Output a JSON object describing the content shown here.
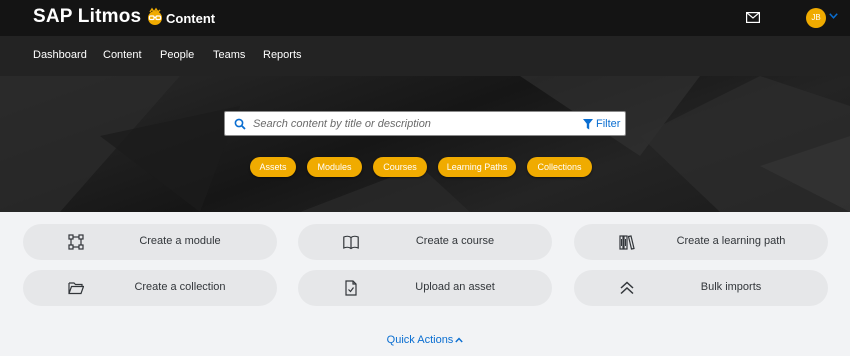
{
  "header": {
    "logo_text": "SAP Litmos",
    "app_title": "Content",
    "avatar_initials": "JB",
    "avatar_color": "#f0ab00"
  },
  "nav": {
    "items": [
      {
        "label": "Dashboard"
      },
      {
        "label": "Content"
      },
      {
        "label": "People"
      },
      {
        "label": "Teams"
      },
      {
        "label": "Reports"
      }
    ]
  },
  "search": {
    "placeholder": "Search content by title or description",
    "value": "",
    "filter_label": "Filter"
  },
  "chips": [
    {
      "label": "Assets"
    },
    {
      "label": "Modules"
    },
    {
      "label": "Courses"
    },
    {
      "label": "Learning Paths"
    },
    {
      "label": "Collections"
    }
  ],
  "actions": [
    {
      "label": "Create a module",
      "icon": "module-icon"
    },
    {
      "label": "Create a course",
      "icon": "book-icon"
    },
    {
      "label": "Create a learning path",
      "icon": "books-icon"
    },
    {
      "label": "Create a collection",
      "icon": "folder-icon"
    },
    {
      "label": "Upload an asset",
      "icon": "document-upload-icon"
    },
    {
      "label": "Bulk imports",
      "icon": "double-chevron-up-icon"
    }
  ],
  "quick_actions": {
    "label": "Quick Actions"
  },
  "colors": {
    "accent": "#f0ab00",
    "link": "#0a6ed1",
    "header_bg": "#141414",
    "nav_bg": "#232323"
  }
}
